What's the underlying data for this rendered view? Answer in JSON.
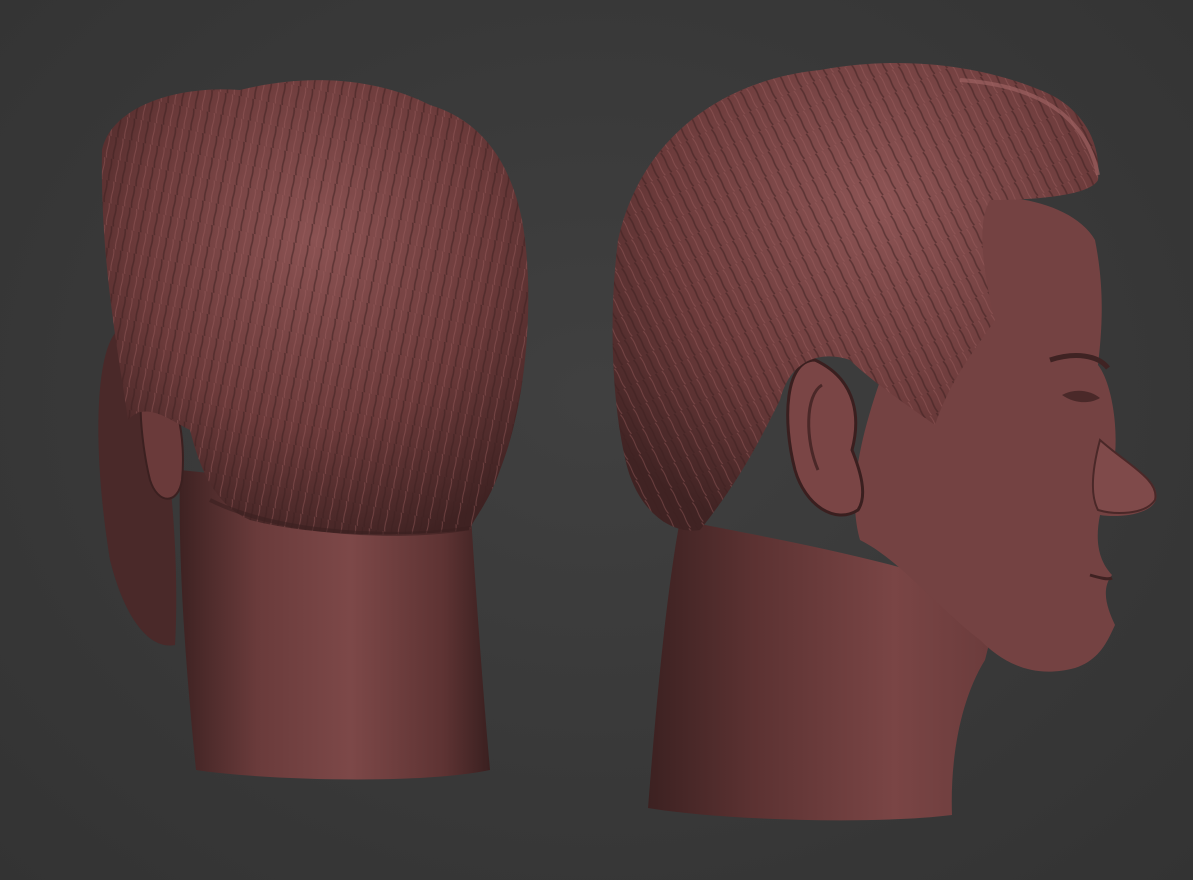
{
  "scene": {
    "background_color": "#3a3a3a",
    "material_color": "#6e3f3f",
    "models": [
      {
        "name": "head-sculpt-back-view",
        "view": "back"
      },
      {
        "name": "head-sculpt-side-view",
        "view": "right-profile"
      }
    ]
  }
}
